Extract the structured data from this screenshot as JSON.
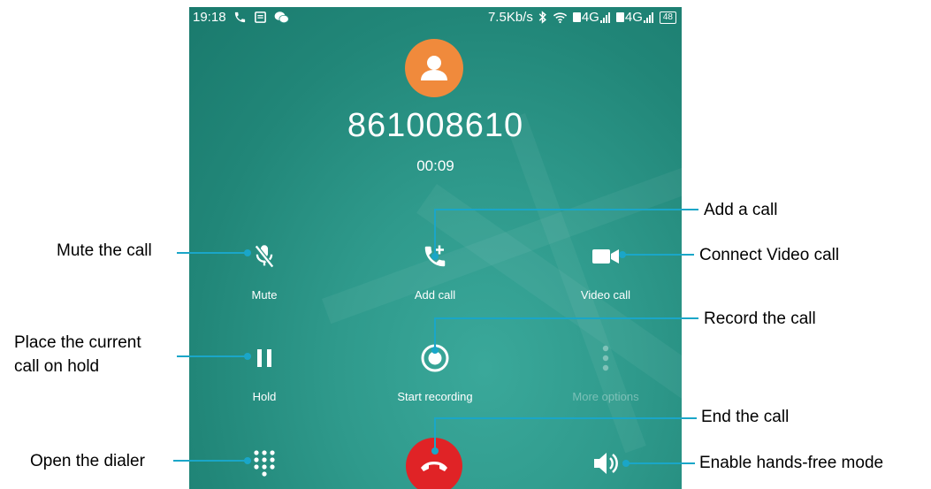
{
  "status_bar": {
    "time": "19:18",
    "left_icons": [
      "phone-icon",
      "message-icon",
      "wechat-icon"
    ],
    "speed": "7.5Kb/s",
    "network1": "4G",
    "network2": "4G",
    "battery": "48"
  },
  "call": {
    "number": "861008610",
    "duration": "00:09"
  },
  "controls": {
    "mute_label": "Mute",
    "add_call_label": "Add call",
    "video_call_label": "Video call",
    "hold_label": "Hold",
    "start_recording_label": "Start recording",
    "more_options_label": "More options"
  },
  "annotations": {
    "add_call": "Add a call",
    "mute": "Mute the call",
    "video": "Connect Video call",
    "hold_line1": "Place  the  current",
    "hold_line2": "call on hold",
    "record": "Record the call",
    "end": "End the call",
    "dialer": "Open the dialer",
    "handsfree": "Enable hands-free mode"
  },
  "colors": {
    "screen": "#2a9486",
    "avatar": "#f08a3c",
    "end_call": "#e02326",
    "leader_line": "#1aa6c8"
  }
}
